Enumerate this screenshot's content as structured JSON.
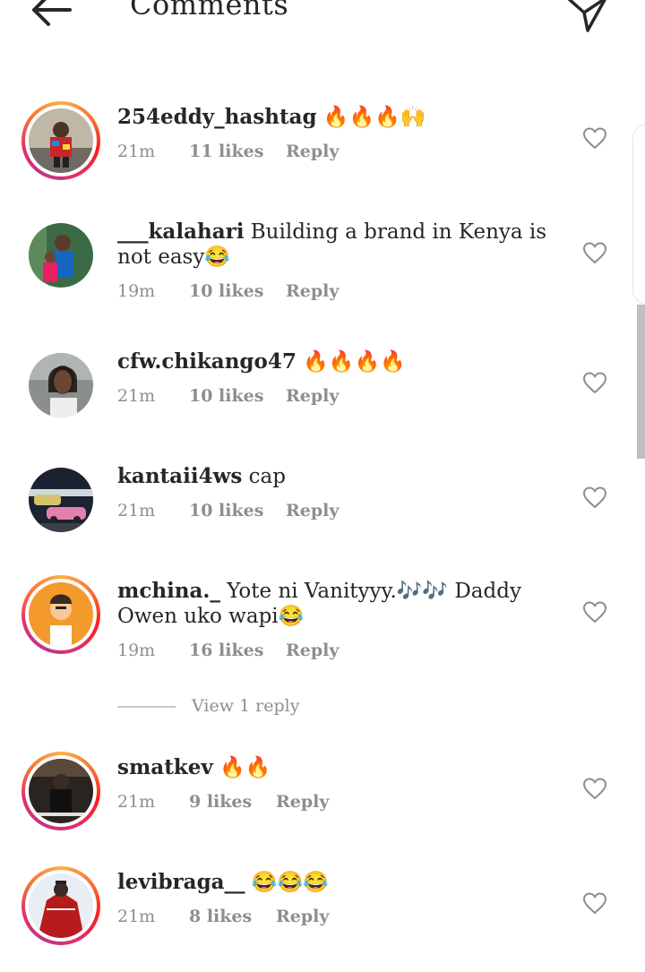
{
  "header": {
    "title": "Comments"
  },
  "comments": [
    {
      "username": "254eddy_hashtag",
      "text": " 🔥🔥🔥🙌",
      "time": "21m",
      "likes": "11 likes",
      "reply": "Reply",
      "ring": true
    },
    {
      "username": "___kalahari",
      "text": " Building a brand in Kenya is not easy😂",
      "time": "19m",
      "likes": "10 likes",
      "reply": "Reply",
      "ring": false
    },
    {
      "username": "cfw.chikango47",
      "text": " 🔥🔥🔥🔥",
      "time": "21m",
      "likes": "10 likes",
      "reply": "Reply",
      "ring": false
    },
    {
      "username": "kantaii4ws",
      "text": " cap",
      "time": "21m",
      "likes": "10 likes",
      "reply": "Reply",
      "ring": false
    },
    {
      "username": "mchina._",
      "text": " Yote ni Vanityyy.🎶🎶 Daddy Owen uko wapi😂",
      "time": "19m",
      "likes": "16 likes",
      "reply": "Reply",
      "ring": true
    },
    {
      "username": "smatkev",
      "text": " 🔥🔥",
      "time": "21m",
      "likes": "9 likes",
      "reply": "Reply",
      "ring": true
    },
    {
      "username": "levibraga__",
      "text": " 😂😂😂",
      "time": "21m",
      "likes": "8 likes",
      "reply": "Reply",
      "ring": true
    }
  ],
  "thread": {
    "view_replies": "View 1 reply"
  },
  "icons": {
    "back": "arrow-left-icon",
    "send": "paper-plane-icon",
    "like": "heart-outline-icon"
  },
  "colors": {
    "text": "#262626",
    "meta": "#8e8e8e",
    "story_ring": "#e1306c"
  }
}
